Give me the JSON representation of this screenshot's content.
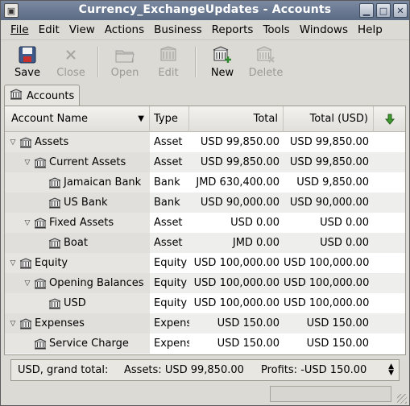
{
  "window": {
    "title": "Currency_ExchangeUpdates - Accounts"
  },
  "menubar": [
    {
      "key": "file",
      "label": "File"
    },
    {
      "key": "edit",
      "label": "Edit"
    },
    {
      "key": "view",
      "label": "View"
    },
    {
      "key": "actions",
      "label": "Actions"
    },
    {
      "key": "business",
      "label": "Business"
    },
    {
      "key": "reports",
      "label": "Reports"
    },
    {
      "key": "tools",
      "label": "Tools"
    },
    {
      "key": "windows",
      "label": "Windows"
    },
    {
      "key": "help",
      "label": "Help"
    }
  ],
  "toolbar": {
    "save": "Save",
    "close": "Close",
    "open": "Open",
    "edit": "Edit",
    "new": "New",
    "delete": "Delete"
  },
  "tab": {
    "label": "Accounts"
  },
  "columns": {
    "name": "Account Name",
    "type": "Type",
    "total": "Total",
    "total_usd": "Total (USD)"
  },
  "accounts": [
    {
      "name": "Assets",
      "type": "Asset",
      "total": "USD 99,850.00",
      "total_usd": "USD 99,850.00"
    },
    {
      "name": "Current Assets",
      "type": "Asset",
      "total": "USD 99,850.00",
      "total_usd": "USD 99,850.00"
    },
    {
      "name": "Jamaican Bank",
      "type": "Bank",
      "total": "JMD 630,400.00",
      "total_usd": "USD 9,850.00"
    },
    {
      "name": "US Bank",
      "type": "Bank",
      "total": "USD 90,000.00",
      "total_usd": "USD 90,000.00"
    },
    {
      "name": "Fixed Assets",
      "type": "Asset",
      "total": "USD 0.00",
      "total_usd": "USD 0.00"
    },
    {
      "name": "Boat",
      "type": "Asset",
      "total": "JMD 0.00",
      "total_usd": "USD 0.00"
    },
    {
      "name": "Equity",
      "type": "Equity",
      "total": "USD 100,000.00",
      "total_usd": "USD 100,000.00"
    },
    {
      "name": "Opening Balances",
      "type": "Equity",
      "total": "USD 100,000.00",
      "total_usd": "USD 100,000.00"
    },
    {
      "name": "USD",
      "type": "Equity",
      "total": "USD 100,000.00",
      "total_usd": "USD 100,000.00"
    },
    {
      "name": "Expenses",
      "type": "Expense",
      "total": "USD 150.00",
      "total_usd": "USD 150.00"
    },
    {
      "name": "Service Charge",
      "type": "Expense",
      "total": "USD 150.00",
      "total_usd": "USD 150.00"
    }
  ],
  "summary": {
    "grand_total": "USD, grand total:",
    "assets": "Assets: USD 99,850.00",
    "profits": "Profits: -USD 150.00"
  },
  "colors": {
    "titlebar": "#6a7a93",
    "alt_row": "#eeeeec"
  }
}
